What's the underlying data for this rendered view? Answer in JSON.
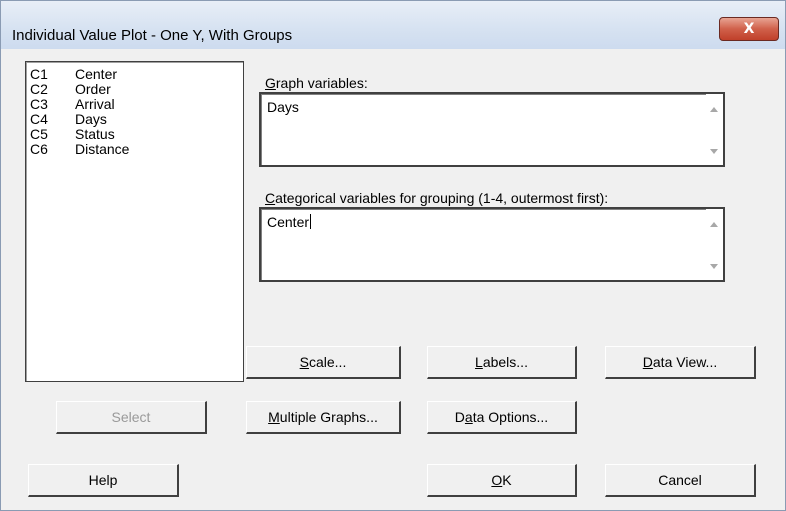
{
  "window": {
    "title": "Individual Value Plot - One Y, With Groups",
    "close_glyph": "X"
  },
  "variables": [
    {
      "col": "C1",
      "name": "Center"
    },
    {
      "col": "C2",
      "name": "Order"
    },
    {
      "col": "C3",
      "name": "Arrival"
    },
    {
      "col": "C4",
      "name": "Days"
    },
    {
      "col": "C5",
      "name": "Status"
    },
    {
      "col": "C6",
      "name": "Distance"
    }
  ],
  "graph_variables": {
    "label_mnemonic": "G",
    "label_rest": "raph variables:",
    "value": "Days"
  },
  "categorical": {
    "label_mnemonic": "C",
    "label_rest": "ategorical variables for grouping (1-4, outermost first):",
    "value": "Center"
  },
  "buttons": {
    "select": "Select",
    "scale_pre": "",
    "scale_mn": "S",
    "scale_post": "cale...",
    "labels_pre": "",
    "labels_mn": "L",
    "labels_post": "abels...",
    "dataview_pre": "",
    "dataview_mn": "D",
    "dataview_post": "ata View...",
    "multi_pre": "",
    "multi_mn": "M",
    "multi_post": "ultiple Graphs...",
    "dataopt_pre": "D",
    "dataopt_mn": "a",
    "dataopt_post": "ta Options...",
    "help": "Help",
    "ok_pre": "",
    "ok_mn": "O",
    "ok_post": "K",
    "cancel": "Cancel"
  }
}
